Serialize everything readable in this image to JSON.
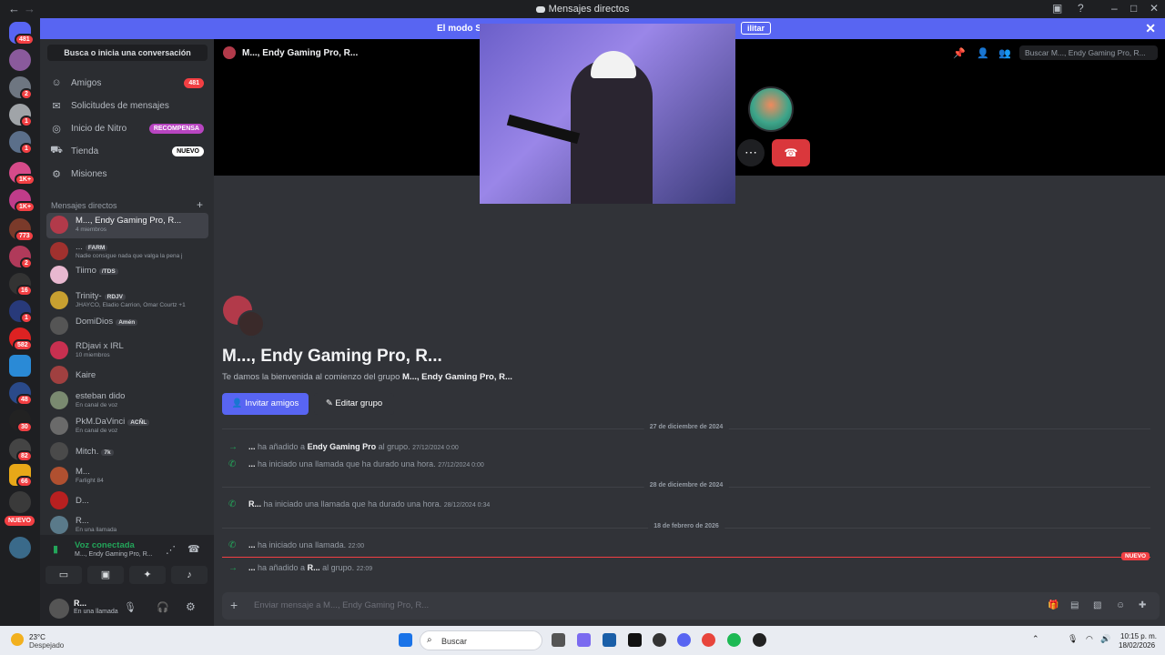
{
  "window": {
    "title": "Mensajes directos"
  },
  "banner": {
    "text": "El modo Stre",
    "button": "ilitar"
  },
  "rail": {
    "badges": [
      "481",
      "2",
      "1",
      "1",
      "1K+",
      "1K+",
      "773",
      "2",
      "16",
      "1",
      "582",
      "48",
      "30",
      "82",
      "66"
    ],
    "new_label": "NUEVO"
  },
  "sidebar": {
    "search": "Busca o inicia una conversación",
    "nav": [
      {
        "label": "Amigos",
        "badge": "481"
      },
      {
        "label": "Solicitudes de mensajes"
      },
      {
        "label": "Inicio de Nitro",
        "badge": "RECOMPENSA"
      },
      {
        "label": "Tienda",
        "badge": "NUEVO"
      },
      {
        "label": "Misiones"
      }
    ],
    "dm_header": "Mensajes directos",
    "dms": [
      {
        "name": "M..., Endy Gaming Pro, R...",
        "sub": "4 miembros"
      },
      {
        "name": "...",
        "tag": "FARM",
        "sub": "Nadie consigue nada que valga la pena j"
      },
      {
        "name": "Tiimo",
        "tag": "/TDS",
        "sub": ""
      },
      {
        "name": "Trinity-",
        "tag": "RDJV",
        "sub": "JHAYCO, Eladio Carrion, Omar Courtz +1"
      },
      {
        "name": "DomiDios",
        "tag": "Amén",
        "sub": ""
      },
      {
        "name": "RDjavi x IRL",
        "sub": "10 miembros"
      },
      {
        "name": "Kaire",
        "sub": ""
      },
      {
        "name": "esteban dido",
        "sub": "En canal de voz"
      },
      {
        "name": "PkM.DaVinci",
        "tag": "ACÑL",
        "sub": "En canal de voz"
      },
      {
        "name": "Mitch.",
        "tag": "7k",
        "sub": ""
      },
      {
        "name": "M...",
        "sub": "Farlight 84"
      },
      {
        "name": "D...",
        "sub": ""
      },
      {
        "name": "R...",
        "sub": "En una llamada"
      }
    ]
  },
  "voice": {
    "status": "Voz conectada",
    "channel": "M..., Endy Gaming Pro, R..."
  },
  "user": {
    "name": "R...",
    "status": "En una llamada"
  },
  "header": {
    "title": "M..., Endy Gaming Pro, R...",
    "search_placeholder": "Buscar M..., Endy Gaming Pro, R..."
  },
  "intro": {
    "title": "M..., Endy Gaming Pro, R...",
    "welcome_prefix": "Te damos la bienvenida al comienzo del grupo ",
    "welcome_group": "M..., Endy Gaming Pro, R...",
    "invite": "Invitar amigos",
    "edit": "Editar grupo"
  },
  "dividers": [
    "27 de diciembre de 2024",
    "28 de diciembre de 2024",
    "18 de febrero de 2026"
  ],
  "messages": [
    {
      "user": "...",
      "text": " ha añadido a ",
      "target": "Endy Gaming Pro",
      "after": " al grupo.",
      "time": "27/12/2024 0:00"
    },
    {
      "user": "...",
      "text": " ha iniciado una llamada que ha durado una hora.",
      "time": "27/12/2024 0:00"
    },
    {
      "user": "R...",
      "text": " ha iniciado una llamada que ha durado una hora.",
      "time": "28/12/2024 0:34"
    },
    {
      "user": "...",
      "text": " ha iniciado una llamada.",
      "time": "22:00"
    },
    {
      "user": "...",
      "text": " ha añadido a ",
      "target": "R...",
      "after": " al grupo.",
      "time": "22:09"
    }
  ],
  "new_label": "NUEVO",
  "composer": {
    "placeholder": "Enviar mensaje a M..., Endy Gaming Pro, R..."
  },
  "taskbar": {
    "temp": "23°C",
    "weather": "Despejado",
    "search": "Buscar",
    "time": "10:15 p. m.",
    "date": "18/02/2026"
  },
  "colors": {
    "blurple": "#5865f2",
    "red": "#da373c",
    "green": "#23a55a"
  }
}
